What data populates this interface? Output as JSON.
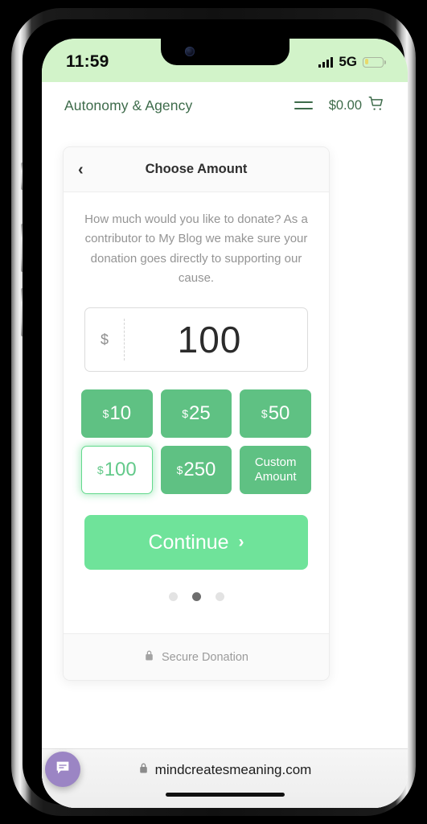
{
  "status_bar": {
    "time": "11:59",
    "network": "5G",
    "signal_icon": "signal-bars-icon",
    "battery_icon": "battery-icon",
    "background_color": "#d2f3c9"
  },
  "site_header": {
    "brand": "Autonomy & Agency",
    "menu_icon": "hamburger-menu-icon",
    "cart_total": "$0.00",
    "cart_icon": "shopping-cart-icon",
    "brand_color": "#3d6b4a"
  },
  "donation_card": {
    "back_icon": "chevron-left-icon",
    "title": "Choose Amount",
    "description": "How much would you like to donate? As a contributor to My Blog we make sure your donation goes directly to supporting our cause.",
    "amount_input": {
      "currency": "$",
      "value": "100",
      "placeholder": "0"
    },
    "amount_options": [
      {
        "currency": "$",
        "amount": "10",
        "selected": false
      },
      {
        "currency": "$",
        "amount": "25",
        "selected": false
      },
      {
        "currency": "$",
        "amount": "50",
        "selected": false
      },
      {
        "currency": "$",
        "amount": "100",
        "selected": true
      },
      {
        "currency": "$",
        "amount": "250",
        "selected": false
      },
      {
        "custom_label": "Custom Amount",
        "selected": false
      }
    ],
    "continue_label": "Continue",
    "continue_chevron": "chevron-right-icon",
    "pagination": {
      "total": 3,
      "active_index": 1
    },
    "footer": {
      "lock_icon": "lock-icon",
      "label": "Secure Donation"
    },
    "accent_green": "#5fc183",
    "continue_green": "#6fe39a",
    "selected_green": "#63c98a"
  },
  "chat_widget": {
    "icon": "chat-bubble-icon",
    "color": "#9b85c4"
  },
  "browser_bar": {
    "lock_icon": "lock-icon",
    "url": "mindcreatesmeaning.com"
  }
}
